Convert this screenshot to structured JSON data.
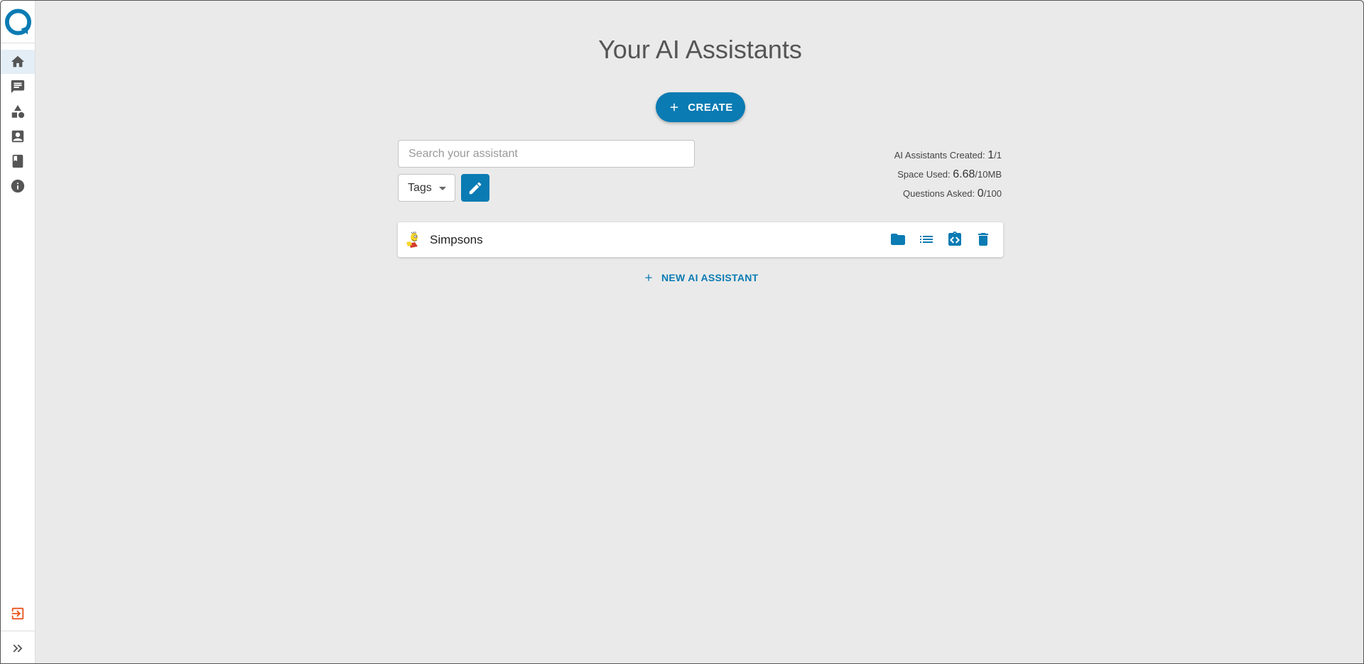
{
  "sidebar": {
    "items": [
      {
        "name": "home",
        "icon": "home-icon",
        "active": true
      },
      {
        "name": "chat",
        "icon": "chat-icon",
        "active": false
      },
      {
        "name": "shapes",
        "icon": "shapes-icon",
        "active": false
      },
      {
        "name": "contacts",
        "icon": "contact-icon",
        "active": false
      },
      {
        "name": "docs",
        "icon": "book-icon",
        "active": false
      },
      {
        "name": "info",
        "icon": "info-icon",
        "active": false
      }
    ],
    "logout_icon": "logout-icon",
    "expand_icon": "double-chevron-right-icon"
  },
  "page": {
    "title": "Your AI Assistants",
    "create_label": "CREATE"
  },
  "search": {
    "placeholder": "Search your assistant",
    "value": ""
  },
  "tags": {
    "label": "Tags"
  },
  "stats": {
    "assistants_label": "AI Assistants Created:",
    "assistants_value": "1",
    "assistants_max": "/1",
    "space_label": "Space Used:",
    "space_value": "6.68",
    "space_max": "/10MB",
    "questions_label": "Questions Asked:",
    "questions_value": "0",
    "questions_max": "/100"
  },
  "assistants": [
    {
      "name": "Simpsons",
      "avatar": "simpsons-avatar"
    }
  ],
  "new_assistant_label": "NEW AI ASSISTANT",
  "colors": {
    "accent": "#0a7bb3",
    "logout": "#e8541e",
    "background": "#eaeaea"
  }
}
